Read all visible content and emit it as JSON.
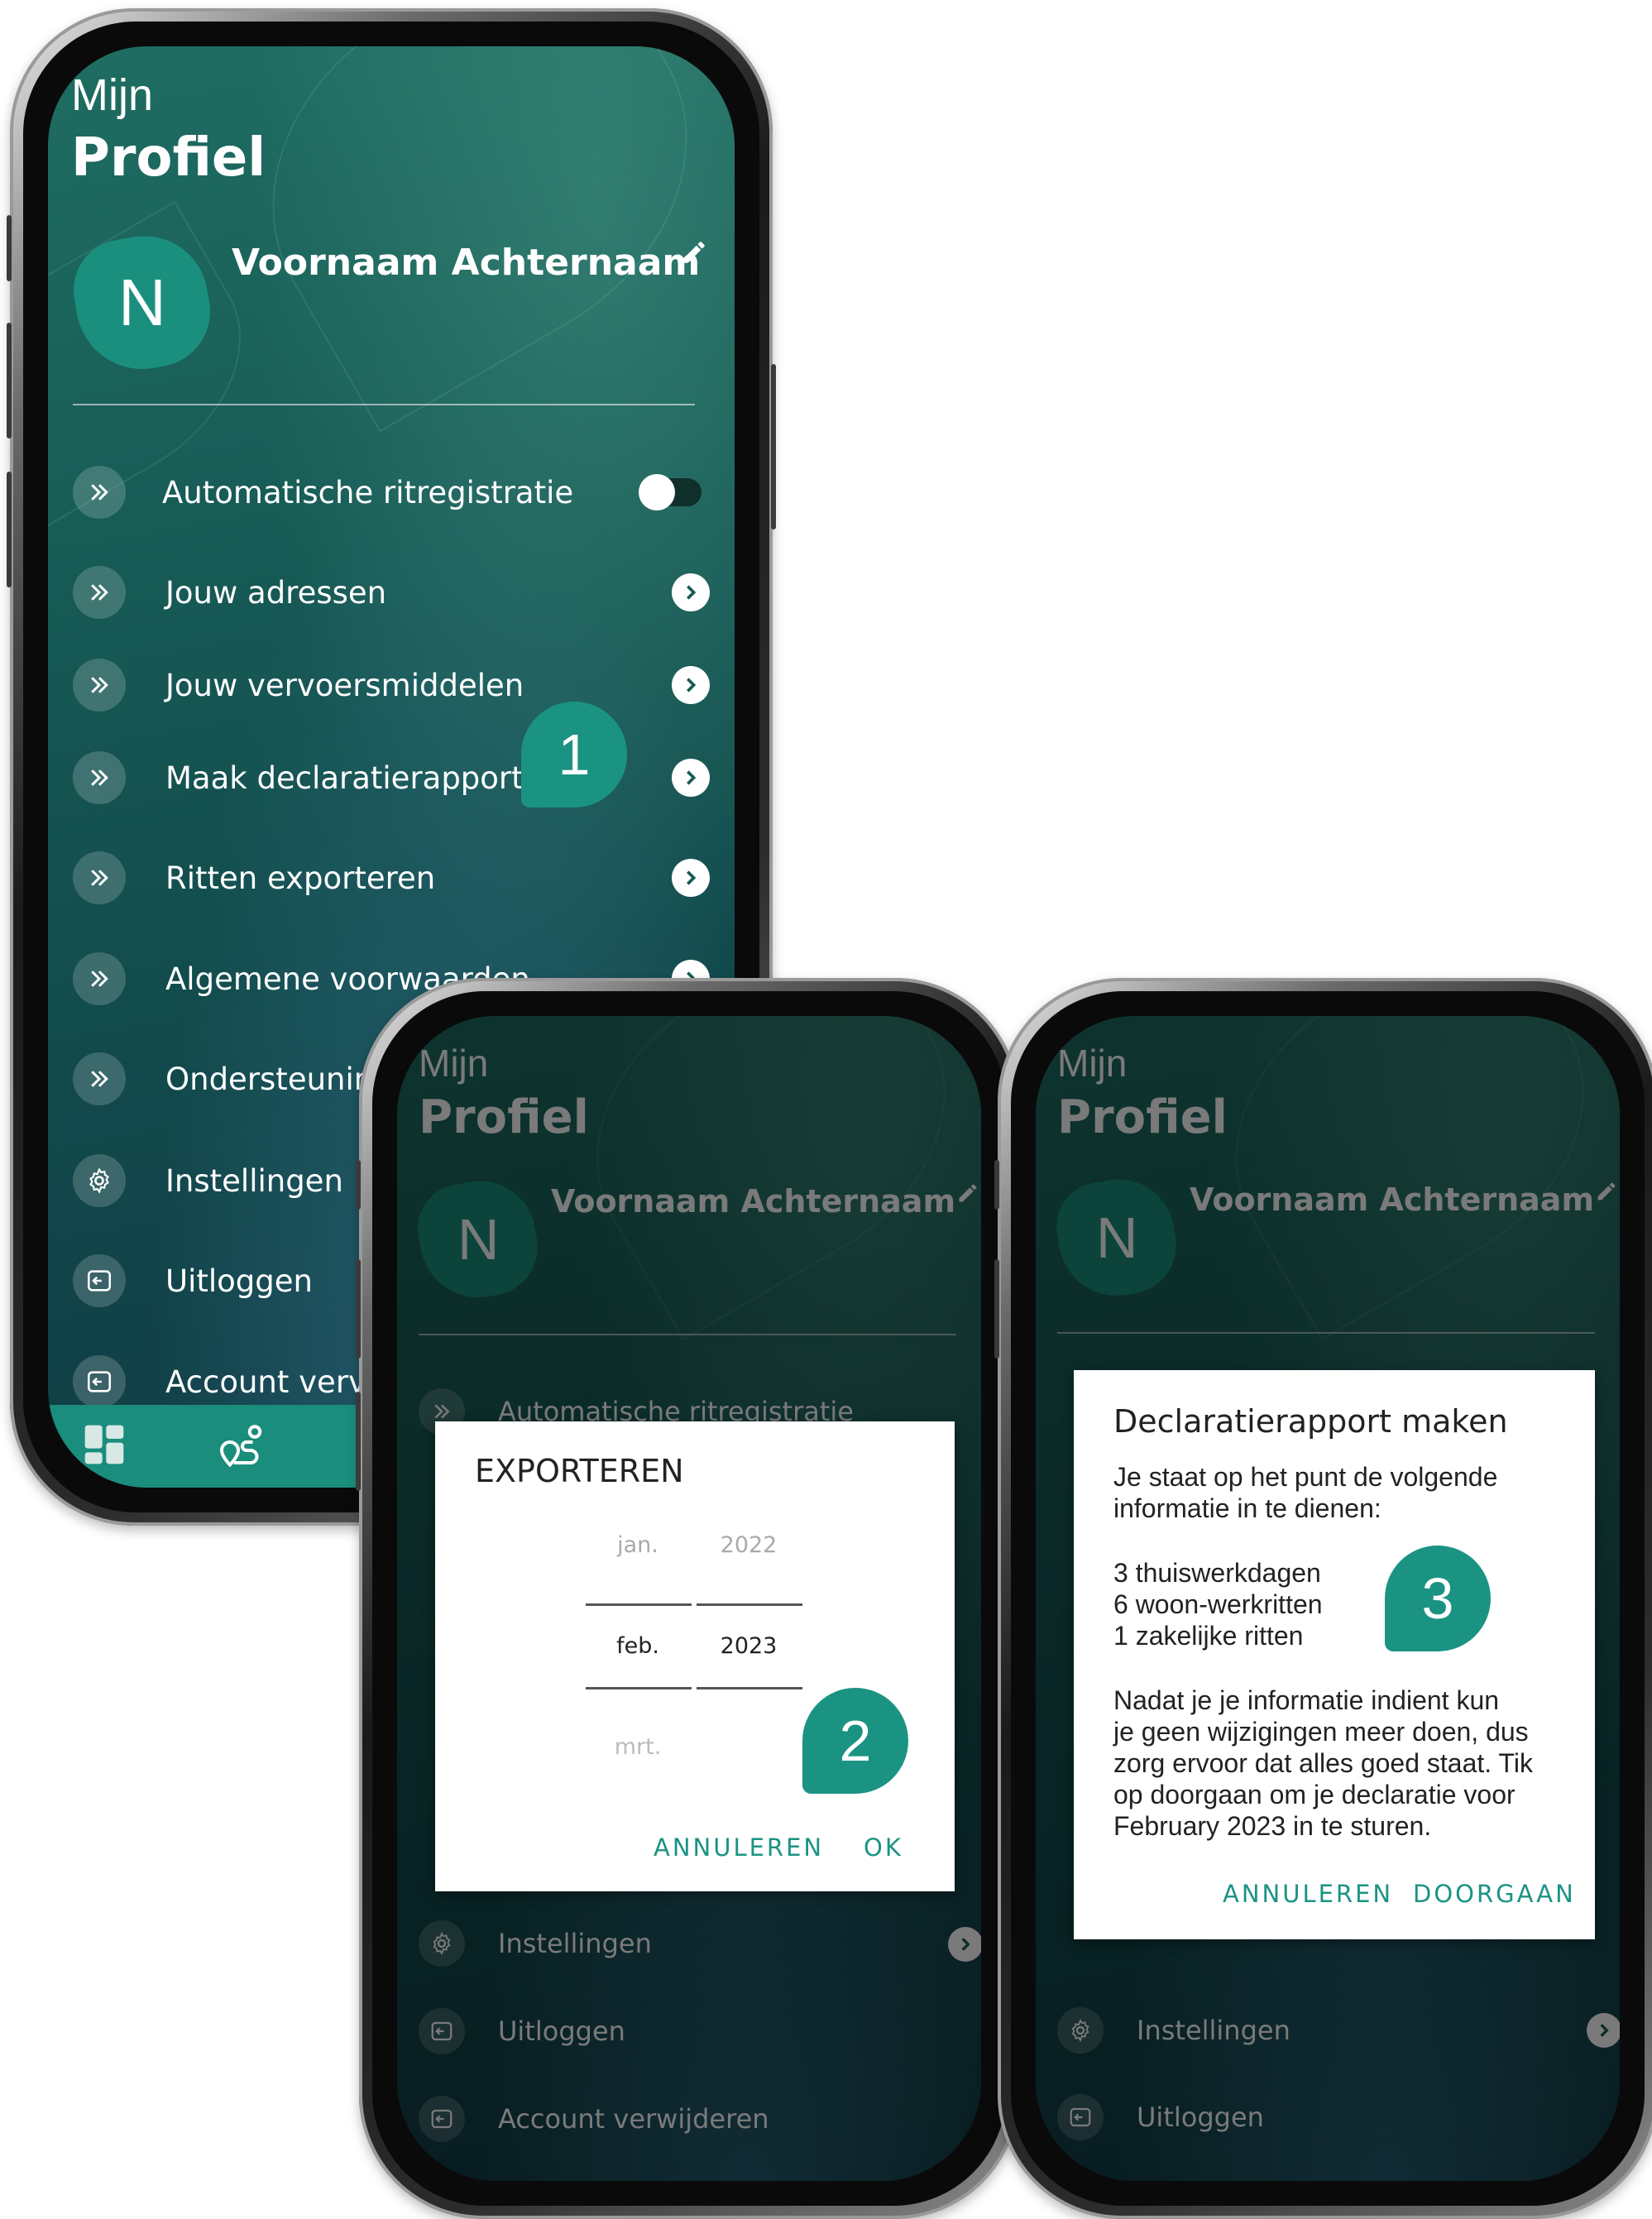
{
  "colors": {
    "accent": "#1b9383",
    "tabbar": "#1a8d7d",
    "screen_bg": "#175a55"
  },
  "profile": {
    "title_small": "Mijn",
    "title_large": "Profiel",
    "avatar_initial": "N",
    "user_name": "Voornaam Achternaam"
  },
  "menu": {
    "auto_registration": "Automatische ritregistratie",
    "addresses": "Jouw adressen",
    "vehicles": "Jouw vervoersmiddelen",
    "expense_report": "Maak declaratierapport",
    "export_trips": "Ritten exporteren",
    "terms": "Algemene voorwaarden",
    "support": "Ondersteunin",
    "settings": "Instellingen",
    "logout": "Uitloggen",
    "delete_account_partial": "Account verv",
    "delete_account": "Account verwijderen"
  },
  "steps": {
    "one": "1",
    "two": "2",
    "three": "3"
  },
  "export_dialog": {
    "title": "EXPORTEREN",
    "months": [
      "jan.",
      "feb.",
      "mrt."
    ],
    "years": [
      "2022",
      "2023"
    ],
    "cancel": "ANNULEREN",
    "ok": "OK"
  },
  "report_dialog": {
    "title": "Declaratierapport maken",
    "intro_line1": "Je staat op het punt de volgende",
    "intro_line2": "informatie in te dienen:",
    "item1": "3 thuiswerkdagen",
    "item2": "6 woon-werkritten",
    "item3": "1 zakelijke ritten",
    "body_line1": "Nadat je je informatie indient kun",
    "body_line2": "je geen wijzigingen meer doen, dus",
    "body_line3": "zorg ervoor dat alles goed staat. Tik",
    "body_line4": "op doorgaan om je declaratie voor",
    "body_line5": "February 2023 in te sturen.",
    "cancel": "ANNULEREN",
    "continue": "DOORGAAN"
  },
  "icons": {
    "menu_arrow": "double-chevron-icon",
    "settings": "gear-icon",
    "logout": "logout-icon",
    "next": "chevron-right-icon",
    "edit": "pencil-icon",
    "tab_dashboard": "dashboard-icon",
    "tab_trips": "route-icon"
  }
}
